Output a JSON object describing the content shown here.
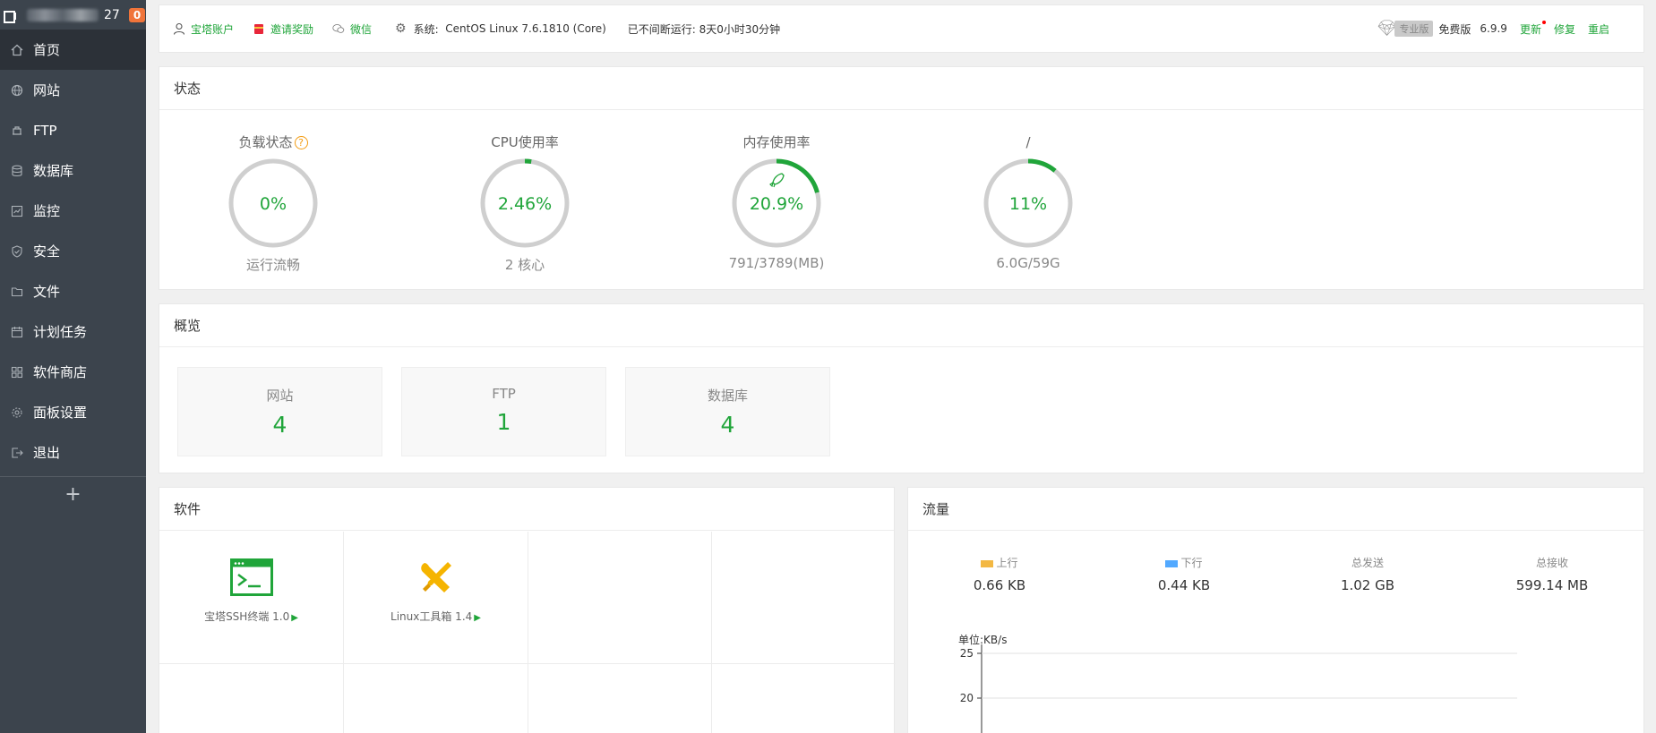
{
  "sidebar": {
    "ip_visible": "27",
    "badge": "0",
    "items": [
      {
        "label": "首页",
        "icon": "home-icon"
      },
      {
        "label": "网站",
        "icon": "globe-icon"
      },
      {
        "label": "FTP",
        "icon": "ftp-icon"
      },
      {
        "label": "数据库",
        "icon": "database-icon"
      },
      {
        "label": "监控",
        "icon": "monitor-icon"
      },
      {
        "label": "安全",
        "icon": "shield-icon"
      },
      {
        "label": "文件",
        "icon": "folder-icon"
      },
      {
        "label": "计划任务",
        "icon": "calendar-icon"
      },
      {
        "label": "软件商店",
        "icon": "grid-icon"
      },
      {
        "label": "面板设置",
        "icon": "gear-icon"
      },
      {
        "label": "退出",
        "icon": "logout-icon"
      }
    ],
    "add": "+"
  },
  "topbar": {
    "account": "宝塔账户",
    "invite": "邀请奖励",
    "wechat": "微信",
    "system_label": "系统:",
    "system_value": "CentOS Linux 7.6.1810 (Core)",
    "uptime": "已不间断运行: 8天0小时30分钟",
    "pro": "专业版",
    "free": "免费版",
    "version": "6.9.9",
    "update": "更新",
    "repair": "修复",
    "restart": "重启"
  },
  "status": {
    "title": "状态",
    "gauges": [
      {
        "label": "负载状态",
        "value": "0%",
        "percent": 0,
        "sub": "运行流畅",
        "help": "?"
      },
      {
        "label": "CPU使用率",
        "value": "2.46%",
        "percent": 2.46,
        "sub": "2 核心"
      },
      {
        "label": "内存使用率",
        "value": "20.9%",
        "percent": 20.9,
        "sub": "791/3789(MB)"
      },
      {
        "label": "/",
        "value": "11%",
        "percent": 11,
        "sub": "6.0G/59G"
      }
    ]
  },
  "overview": {
    "title": "概览",
    "cards": [
      {
        "label": "网站",
        "value": "4"
      },
      {
        "label": "FTP",
        "value": "1"
      },
      {
        "label": "数据库",
        "value": "4"
      }
    ]
  },
  "software": {
    "title": "软件",
    "items": [
      {
        "name": "宝塔SSH终端 1.0",
        "icon": "terminal-icon"
      },
      {
        "name": "Linux工具箱 1.4",
        "icon": "tools-icon"
      }
    ]
  },
  "traffic": {
    "title": "流量",
    "stats": [
      {
        "label": "上行",
        "value": "0.66 KB"
      },
      {
        "label": "下行",
        "value": "0.44 KB"
      },
      {
        "label": "总发送",
        "value": "1.02 GB"
      },
      {
        "label": "总接收",
        "value": "599.14 MB"
      }
    ],
    "unit": "单位:KB/s",
    "yticks": [
      "25",
      "20"
    ]
  },
  "colors": {
    "accent": "#20a53a",
    "sidebar": "#3c444d",
    "badge": "#f0743a",
    "upload": "#f3b843",
    "download": "#52a9ff"
  }
}
